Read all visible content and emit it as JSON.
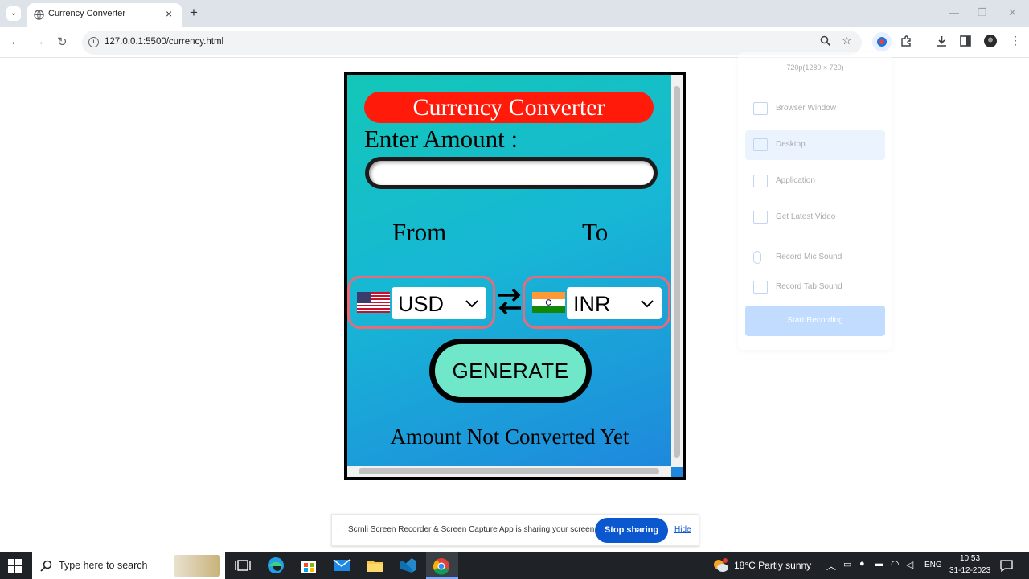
{
  "browser": {
    "tab_title": "Currency Converter",
    "close_glyph": "×",
    "new_tab_glyph": "+",
    "url": "127.0.0.1:5500/currency.html",
    "window_controls": [
      "—",
      "❐",
      "✕"
    ]
  },
  "app": {
    "title": "Currency Converter",
    "enter_amount_label": "Enter Amount :",
    "amount_value": "",
    "from_label": "From",
    "to_label": "To",
    "from_currency": "USD",
    "to_currency": "INR",
    "generate_label": "GENERATE",
    "result_text": "Amount Not Converted Yet",
    "colors": {
      "title_bg": "#ff1a0a",
      "button_bg": "#6fe7c8",
      "select_border": "#e86b7a"
    }
  },
  "recorder": {
    "resolution": "720p(1280 × 720)",
    "items": [
      "Browser Window",
      "Desktop",
      "Application",
      "Get Latest Video",
      "Record Mic Sound",
      "Record Tab Sound"
    ],
    "start_label": "Start Recording"
  },
  "sharing_bar": {
    "message": "Scrnli Screen Recorder & Screen Capture App is sharing your screen.",
    "stop_label": "Stop sharing",
    "hide_label": "Hide"
  },
  "taskbar": {
    "search_placeholder": "Type here to search",
    "weather": "18°C  Partly sunny",
    "language": "ENG",
    "time": "10:53",
    "date": "31-12-2023"
  }
}
